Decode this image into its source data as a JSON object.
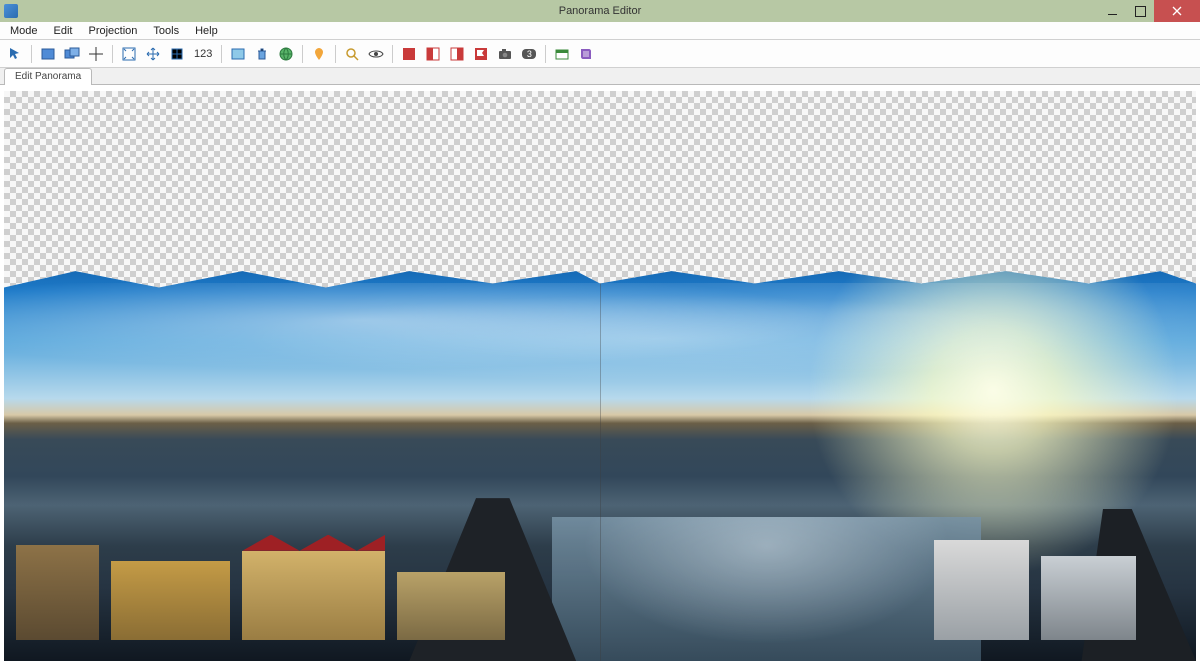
{
  "window": {
    "title": "Panorama Editor"
  },
  "menu": {
    "items": [
      "Mode",
      "Edit",
      "Projection",
      "Tools",
      "Help"
    ]
  },
  "toolbar": {
    "numeric_label": "123",
    "badge_label": "3"
  },
  "tabs": {
    "active": "Edit Panorama"
  }
}
